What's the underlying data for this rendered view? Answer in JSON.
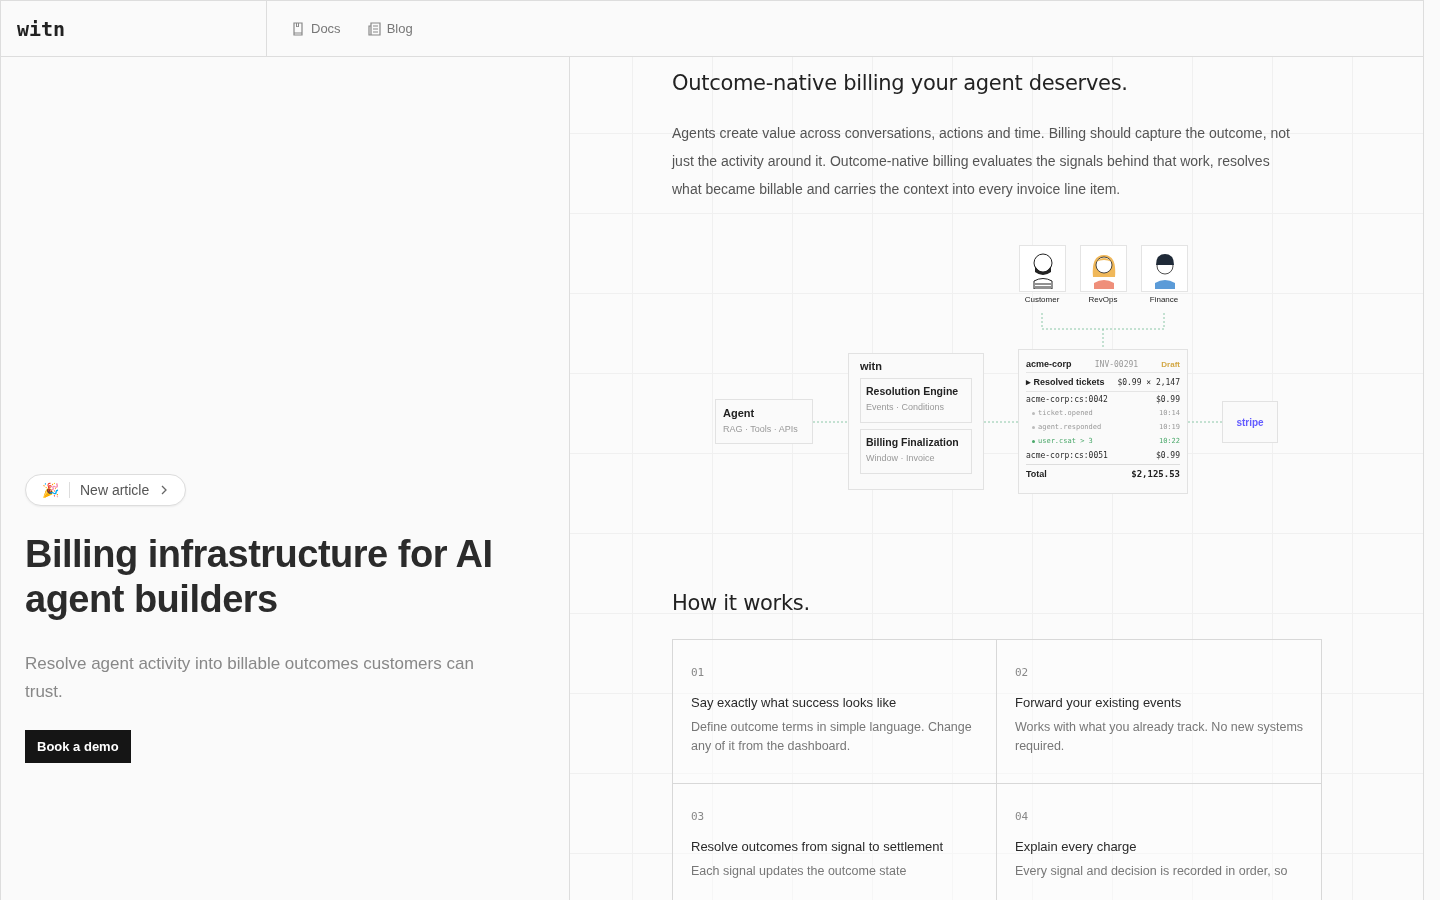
{
  "header": {
    "logo": "witn",
    "nav": [
      {
        "label": "Docs"
      },
      {
        "label": "Blog"
      }
    ]
  },
  "hero": {
    "badge": {
      "emoji": "🎉",
      "label": "New article"
    },
    "title": "Billing infrastructure for AI agent builders",
    "subtitle": "Resolve agent activity into billable outcomes customers can trust.",
    "button": "Book a demo"
  },
  "intro": {
    "title": "Outcome-native billing your agent deserves.",
    "text": "Agents create value across conversations, actions and time. Billing should capture the outcome, not just the activity around it. Outcome-native billing evaluates the signals behind that work, resolves what became billable and carries the context into every invoice line item."
  },
  "diagram": {
    "roles": [
      {
        "label": "Customer"
      },
      {
        "label": "RevOps"
      },
      {
        "label": "Finance"
      }
    ],
    "agent": {
      "title": "Agent",
      "subtitle": "RAG · Tools · APIs"
    },
    "platform": {
      "title": "witn",
      "modules": [
        {
          "title": "Resolution Engine",
          "subtitle": "Events · Conditions"
        },
        {
          "title": "Billing Finalization",
          "subtitle": "Window · Invoice"
        }
      ]
    },
    "invoice": {
      "customer": "acme-corp",
      "number": "INV-00291",
      "status": "Draft",
      "group": {
        "label": "▸ Resolved tickets",
        "price": "$0.99 × 2,147"
      },
      "lines": [
        {
          "kind": "item",
          "label": "acme-corp:cs:0042",
          "value": "$0.99"
        },
        {
          "kind": "event",
          "label": "ticket.opened",
          "value": "10:14",
          "matched": false
        },
        {
          "kind": "event",
          "label": "agent.responded",
          "value": "10:19",
          "matched": false
        },
        {
          "kind": "event",
          "label": "user.csat > 3",
          "value": "10:22",
          "matched": true
        },
        {
          "kind": "item",
          "label": "acme-corp:cs:0051",
          "value": "$0.99"
        }
      ],
      "total_label": "Total",
      "total": "$2,125.53"
    },
    "payment": {
      "label": "stripe"
    }
  },
  "how": {
    "title": "How it works.",
    "steps": [
      {
        "number": "01",
        "title": "Say exactly what success looks like",
        "text": "Define outcome terms in simple language. Change any of it from the dashboard."
      },
      {
        "number": "02",
        "title": "Forward your existing events",
        "text": "Works with what you already track. No new systems required."
      },
      {
        "number": "03",
        "title": "Resolve outcomes from signal to settlement",
        "text": "Each signal updates the outcome state"
      },
      {
        "number": "04",
        "title": "Explain every charge",
        "text": "Every signal and decision is recorded in order, so"
      }
    ]
  }
}
